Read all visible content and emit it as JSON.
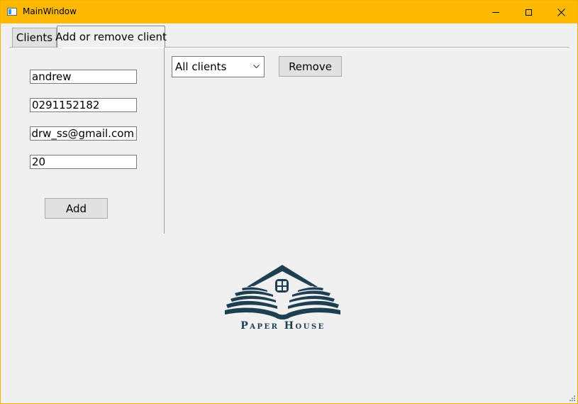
{
  "window": {
    "title": "MainWindow"
  },
  "tabs": [
    {
      "label": "Clients"
    },
    {
      "label": "Add or remove client",
      "selected": true
    }
  ],
  "form": {
    "name_value": "andrew",
    "phone_value": "0291152182",
    "email_value": "andrw_ss@gmail.com",
    "age_value": "20",
    "add_label": "Add"
  },
  "remove_panel": {
    "combo_value": "All clients",
    "remove_label": "Remove"
  },
  "logo": {
    "text": "Paper House",
    "color": "#1e3f52"
  },
  "colors": {
    "titlebar": "#ffb900",
    "background": "#f0f0f0"
  }
}
